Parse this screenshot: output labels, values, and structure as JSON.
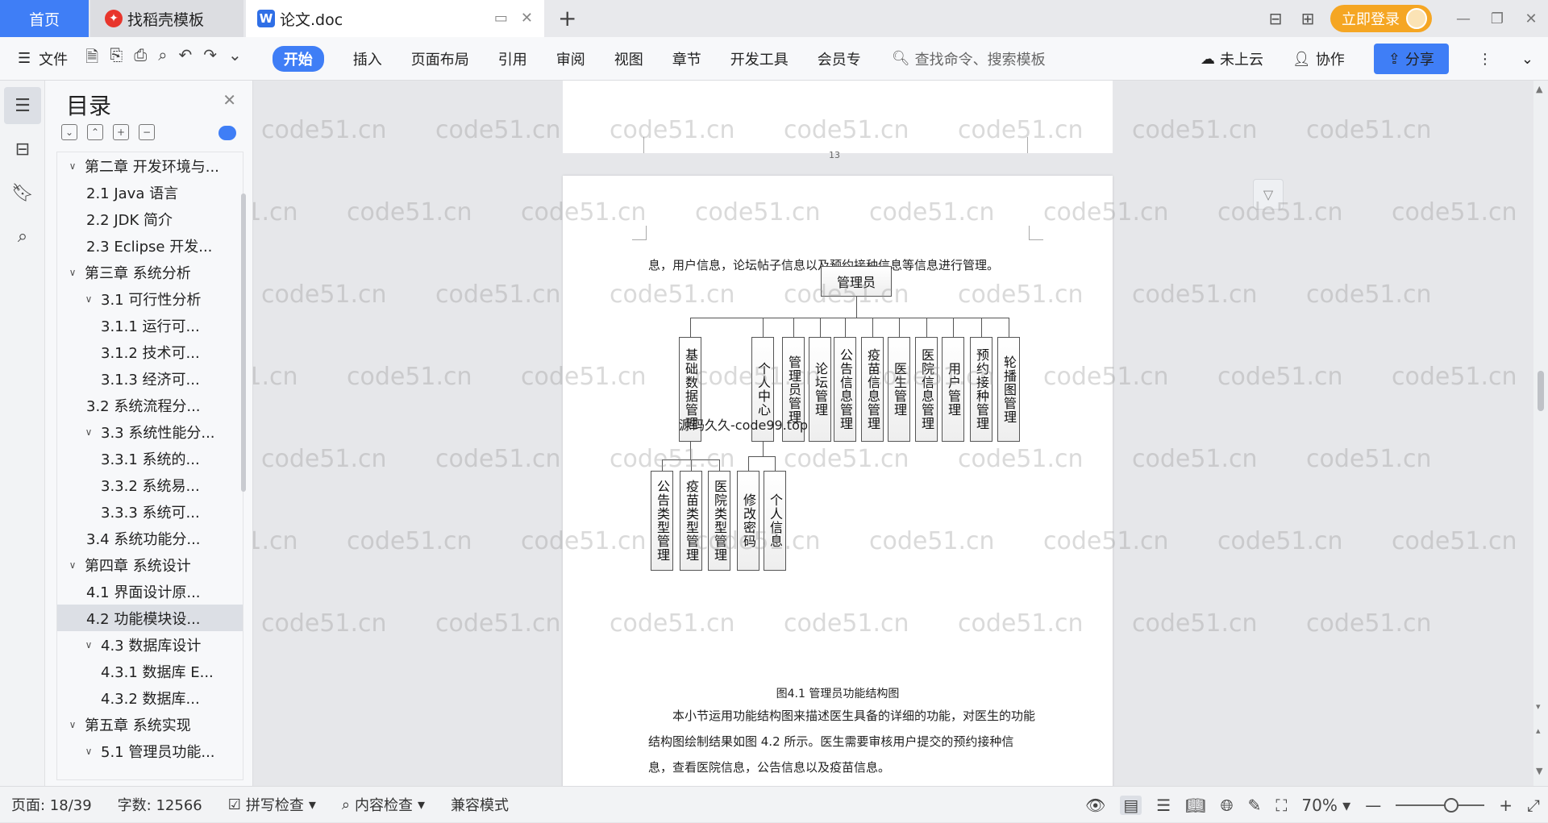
{
  "tabs": {
    "home": "首页",
    "template": "找稻壳模板",
    "doc": "论文.doc"
  },
  "topbar": {
    "login": "立即登录"
  },
  "ribbon": {
    "file": "文件",
    "tabs": [
      "开始",
      "插入",
      "页面布局",
      "引用",
      "审阅",
      "视图",
      "章节",
      "开发工具",
      "会员专"
    ],
    "search_placeholder": "查找命令、搜索模板",
    "cloud": "未上云",
    "collab": "协作",
    "share": "分享"
  },
  "toc": {
    "title": "目录",
    "items": [
      {
        "label": "第二章 开发环境与...",
        "level": "lvl1",
        "caret": "∨"
      },
      {
        "label": "2.1 Java 语言",
        "level": "lvl2",
        "caret": ""
      },
      {
        "label": "2.2 JDK 简介",
        "level": "lvl2",
        "caret": ""
      },
      {
        "label": "2.3 Eclipse 开发...",
        "level": "lvl2",
        "caret": ""
      },
      {
        "label": "第三章 系统分析",
        "level": "lvl1",
        "caret": "∨"
      },
      {
        "label": "3.1 可行性分析",
        "level": "lvl2c",
        "caret": "∨"
      },
      {
        "label": "3.1.1 运行可...",
        "level": "lvl3",
        "caret": ""
      },
      {
        "label": "3.1.2 技术可...",
        "level": "lvl3",
        "caret": ""
      },
      {
        "label": "3.1.3 经济可...",
        "level": "lvl3",
        "caret": ""
      },
      {
        "label": "3.2 系统流程分...",
        "level": "lvl2",
        "caret": ""
      },
      {
        "label": "3.3 系统性能分...",
        "level": "lvl2c",
        "caret": "∨"
      },
      {
        "label": "3.3.1 系统的...",
        "level": "lvl3",
        "caret": ""
      },
      {
        "label": "3.3.2 系统易...",
        "level": "lvl3",
        "caret": ""
      },
      {
        "label": "3.3.3 系统可...",
        "level": "lvl3",
        "caret": ""
      },
      {
        "label": "3.4 系统功能分...",
        "level": "lvl2",
        "caret": ""
      },
      {
        "label": "第四章 系统设计",
        "level": "lvl1",
        "caret": "∨"
      },
      {
        "label": "4.1 界面设计原...",
        "level": "lvl2",
        "caret": ""
      },
      {
        "label": "4.2 功能模块设...",
        "level": "lvl2",
        "caret": "",
        "selected": true
      },
      {
        "label": "4.3 数据库设计",
        "level": "lvl2c",
        "caret": "∨"
      },
      {
        "label": "4.3.1 数据库 E...",
        "level": "lvl3",
        "caret": ""
      },
      {
        "label": "4.3.2 数据库...",
        "level": "lvl3",
        "caret": ""
      },
      {
        "label": "第五章 系统实现",
        "level": "lvl1",
        "caret": "∨"
      },
      {
        "label": "5.1 管理员功能...",
        "level": "lvl2c",
        "caret": "∨"
      }
    ]
  },
  "document": {
    "prev_page_number": "13",
    "intro": "息，用户信息，论坛帖子信息以及预约接种信息等信息进行管理。",
    "root_node": "管理员",
    "level1_nodes": [
      "基础数据管理",
      "个人中心",
      "管理员管理",
      "论坛管理",
      "公告信息管理",
      "疫苗信息管理",
      "医生管理",
      "医院信息管理",
      "用户管理",
      "预约接种管理",
      "轮播图管理"
    ],
    "base_children": [
      "公告类型管理",
      "疫苗类型管理",
      "医院类型管理"
    ],
    "center_children": [
      "修改密码",
      "个人信息"
    ],
    "caption": "图4.1 管理员功能结构图",
    "paragraph": "本小节运用功能结构图来描述医生具备的详细的功能，对医生的功能结构图绘制结果如图 4.2 所示。医生需要审核用户提交的预约接种信息，查看医院信息，公告信息以及疫苗信息。",
    "source_tag": "源码久久-code99.top",
    "watermark": "code51.cn"
  },
  "status": {
    "page": "页面: 18/39",
    "words": "字数: 12566",
    "spell": "拼写检查",
    "content": "内容检查",
    "compat": "兼容模式",
    "zoom": "70%"
  }
}
